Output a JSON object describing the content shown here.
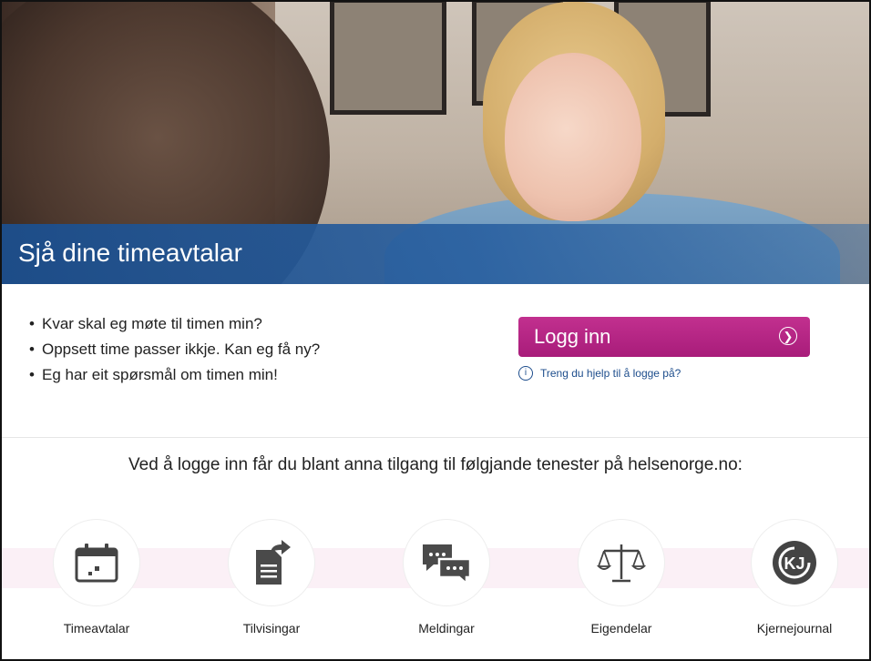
{
  "hero": {
    "title": "Sjå dine timeavtalar"
  },
  "questions": [
    "Kvar skal eg møte til timen min?",
    "Oppsett time passer ikkje. Kan eg få ny?",
    "Eg har eit spørsmål om timen min!"
  ],
  "login": {
    "button_label": "Logg inn",
    "button_icon": "chevron-right-circle-icon",
    "help_icon": "info-icon",
    "help_text": "Treng du hjelp til å logge på?",
    "color": "#b0237f"
  },
  "intro": "Ved å logge inn får du blant anna tilgang til følgjande tenester på helsenorge.no:",
  "services": [
    {
      "label": "Timeavtalar",
      "icon": "calendar-icon"
    },
    {
      "label": "Tilvisingar",
      "icon": "document-forward-icon"
    },
    {
      "label": "Meldingar",
      "icon": "chat-bubbles-icon"
    },
    {
      "label": "Eigendelar",
      "icon": "scales-icon"
    },
    {
      "label": "Kjernejournal",
      "icon": "kj-logo-icon"
    }
  ]
}
